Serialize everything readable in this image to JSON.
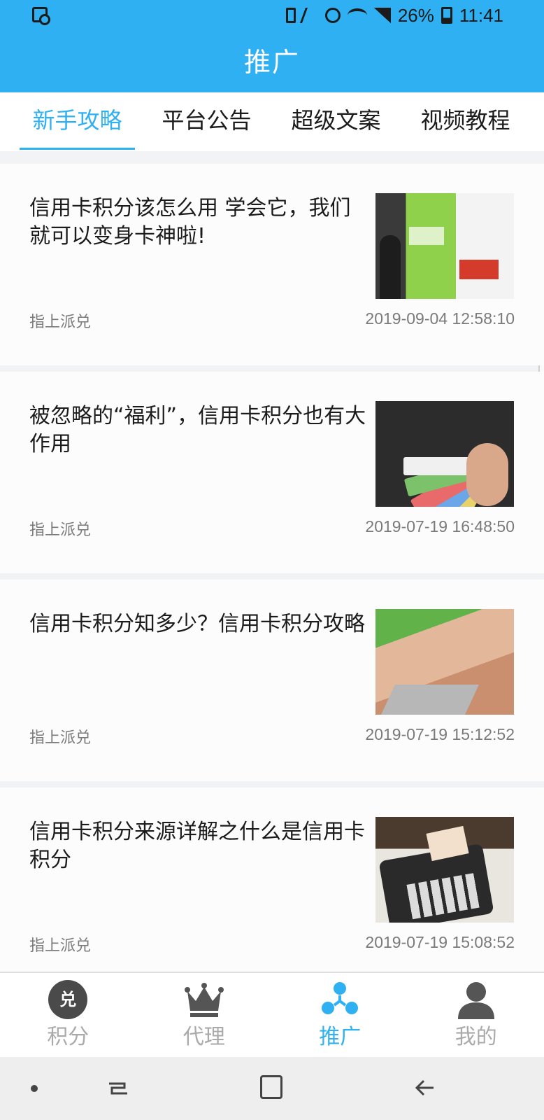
{
  "status_bar": {
    "battery_percent": "26%",
    "time": "11:41"
  },
  "header": {
    "title": "推广"
  },
  "tabs": [
    {
      "label": "新手攻略",
      "active": true
    },
    {
      "label": "平台公告",
      "active": false
    },
    {
      "label": "超级文案",
      "active": false
    },
    {
      "label": "视频教程",
      "active": false
    }
  ],
  "articles": [
    {
      "title": "信用卡积分该怎么用 学会它，我们就可以变身卡神啦!",
      "source": "指上派兑",
      "date": "2019-09-04 12:58:10"
    },
    {
      "title": "被忽略的“福利”，信用卡积分也有大作用",
      "source": "指上派兑",
      "date": "2019-07-19 16:48:50"
    },
    {
      "title": "信用卡积分知多少？信用卡积分攻略",
      "source": "指上派兑",
      "date": "2019-07-19 15:12:52"
    },
    {
      "title": "信用卡积分来源详解之什么是信用卡积分",
      "source": "指上派兑",
      "date": "2019-07-19 15:08:52"
    }
  ],
  "bottom_nav": [
    {
      "label": "积分",
      "icon": "dui-icon",
      "icon_text": "兑",
      "active": false
    },
    {
      "label": "代理",
      "icon": "crown-icon",
      "active": false
    },
    {
      "label": "推广",
      "icon": "share-icon",
      "active": true
    },
    {
      "label": "我的",
      "icon": "user-icon",
      "active": false
    }
  ],
  "colors": {
    "accent": "#2fb0f2",
    "inactive_nav": "#aaaaaa",
    "text_dark": "#1b1b1b",
    "text_muted": "#7a7a7a"
  }
}
